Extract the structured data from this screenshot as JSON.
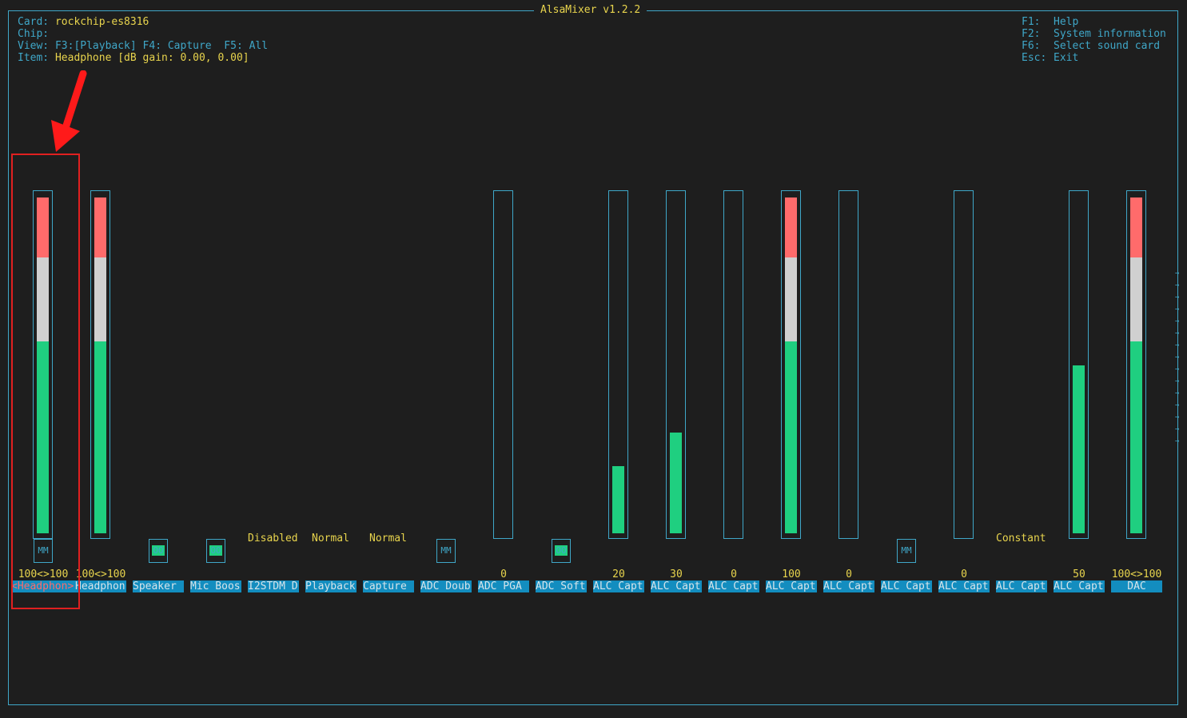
{
  "title": "AlsaMixer v1.2.2",
  "info": {
    "card_label": "Card:",
    "card_value": "rockchip-es8316",
    "chip_label": "Chip:",
    "chip_value": "",
    "view_label": "View:",
    "view_value": "F3:[Playback] F4: Capture  F5: All",
    "item_label": "Item:",
    "item_value": "Headphone [dB gain: 0.00, 0.00]"
  },
  "help": [
    {
      "key": "F1:",
      "desc": "Help"
    },
    {
      "key": "F2:",
      "desc": "System information"
    },
    {
      "key": "F6:",
      "desc": "Select sound card"
    },
    {
      "key": "Esc:",
      "desc": "Exit"
    }
  ],
  "controls": [
    {
      "name": "<Headphon>",
      "value": "100<>100",
      "level": 1.0,
      "mute": "MM",
      "selected": true
    },
    {
      "name": "Headphon",
      "value": "100<>100",
      "level": 1.0,
      "mute": ""
    },
    {
      "name": "Speaker",
      "value": "",
      "mute": "OO"
    },
    {
      "name": "Mic Boos",
      "value": "",
      "mute": "OO"
    },
    {
      "name": "I2STDM D",
      "value": "",
      "enum": "Disabled"
    },
    {
      "name": "Playback",
      "value": "",
      "enum": "Normal"
    },
    {
      "name": "Capture",
      "value": "",
      "enum": "Normal"
    },
    {
      "name": "ADC Doub",
      "value": "",
      "mute": "MM"
    },
    {
      "name": "ADC PGA",
      "value": "0",
      "level": 0.0
    },
    {
      "name": "ADC Soft",
      "value": "",
      "mute": "OO"
    },
    {
      "name": "ALC Capt",
      "value": "20",
      "level": 0.2
    },
    {
      "name": "ALC Capt",
      "value": "30",
      "level": 0.3
    },
    {
      "name": "ALC Capt",
      "value": "0",
      "level": 0.0
    },
    {
      "name": "ALC Capt",
      "value": "100",
      "level": 1.0
    },
    {
      "name": "ALC Capt",
      "value": "0",
      "level": 0.0
    },
    {
      "name": "ALC Capt",
      "value": "",
      "mute": "MM"
    },
    {
      "name": "ALC Capt",
      "value": "0",
      "level": 0.0
    },
    {
      "name": "ALC Capt",
      "value": "",
      "enum": "Constant"
    },
    {
      "name": "ALC Capt",
      "value": "50",
      "level": 0.5
    },
    {
      "name": "DAC",
      "value": "100<>100",
      "level": 1.0
    }
  ],
  "scroll_arrows": [
    "→",
    "→",
    "→",
    "→",
    "→",
    "→",
    "→",
    "→",
    "→",
    "→",
    "→",
    "→",
    "→",
    "→",
    "→"
  ],
  "colors": {
    "accent": "#3fa7c8",
    "text": "#e8d44d",
    "label_bg": "#138dbf",
    "red": "#ff6b6b",
    "green": "#1fcf80",
    "annotation": "#e02020"
  }
}
